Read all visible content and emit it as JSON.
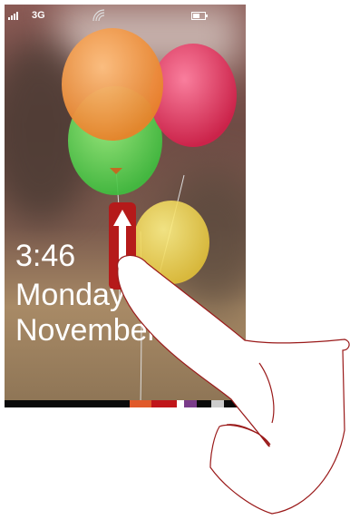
{
  "status_bar": {
    "network": "3G",
    "signal_bars": 4,
    "battery_level": 0.6,
    "icons": [
      "signal-icon",
      "wifi-icon",
      "battery-icon"
    ]
  },
  "lock_screen": {
    "time": "3:46",
    "day": "Monday",
    "date": "November",
    "unlock_handle_icon": "arrow-up-icon"
  },
  "colors": {
    "accent": "#b51a1a",
    "tiles": [
      "#e05a2a",
      "#c0161a",
      "#ffffff",
      "#7a3c8a",
      "#cccccc"
    ]
  },
  "illustration": "finger-swipe-up-gesture"
}
